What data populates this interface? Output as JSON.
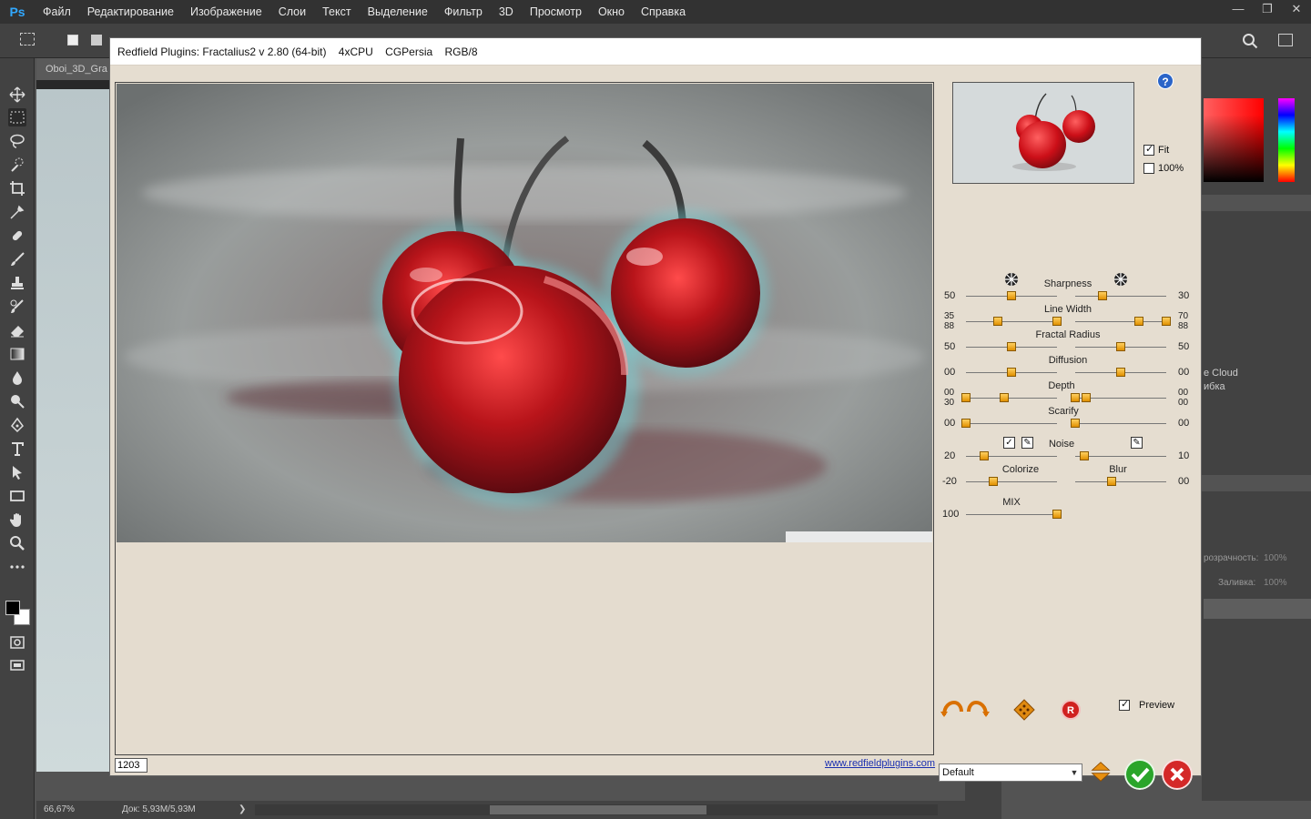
{
  "app": {
    "logo": "Ps",
    "menu": [
      "Файл",
      "Редактирование",
      "Изображение",
      "Слои",
      "Текст",
      "Выделение",
      "Фильтр",
      "3D",
      "Просмотр",
      "Окно",
      "Справка"
    ],
    "window_controls": [
      "—",
      "❐",
      "✕"
    ]
  },
  "document": {
    "tab": "Oboi_3D_Gra",
    "zoom": "66,67%",
    "doc_info": "Док: 5,93M/5,93M",
    "status_arrow": "❯"
  },
  "side_panel": {
    "cloud_text_1": "e Cloud",
    "cloud_text_2": "ибка",
    "opacity_label": "розрачность:",
    "opacity_value": "100%",
    "fill_label": "Заливка:",
    "fill_value": "100%"
  },
  "dialog": {
    "title_parts": [
      "Redfield Plugins: Fractalius2 v 2.80 (64-bit)",
      "4xCPU",
      "CGPersia",
      "RGB/8"
    ],
    "help_label": "?",
    "fit_label": "Fit",
    "fit_checked": true,
    "hundred_label": "100%",
    "hundred_checked": false,
    "coord_value": "1203",
    "link": "www.redfieldplugins.com",
    "preview_label": "Preview",
    "preview_checked": true,
    "preset": "Default",
    "controls": {
      "sharpness": {
        "label": "Sharpness",
        "left": "50",
        "right": "30"
      },
      "line_width": {
        "label": "Line Width",
        "left_top": "35",
        "left_bottom": "88",
        "right_top": "70",
        "right_bottom": "88"
      },
      "fractal_radius": {
        "label": "Fractal Radius",
        "left": "50",
        "right": "50"
      },
      "diffusion": {
        "label": "Diffusion",
        "left": "00",
        "right": "00"
      },
      "depth": {
        "label": "Depth",
        "left_top": "00",
        "left_bottom": "30",
        "right_top": "00",
        "right_bottom": "00"
      },
      "scarify": {
        "label": "Scarify",
        "left": "00",
        "right": "00"
      },
      "noise": {
        "label": "Noise",
        "left": "20",
        "right": "10"
      },
      "colorize": {
        "label": "Colorize",
        "value": "-20"
      },
      "blur": {
        "label": "Blur",
        "value": "00"
      },
      "mix": {
        "label": "MIX",
        "value": "100"
      }
    },
    "colors": {
      "knob": "#f0a800",
      "ok": "#2aa52a",
      "cancel": "#d42828",
      "link": "#1a2fb0"
    }
  }
}
